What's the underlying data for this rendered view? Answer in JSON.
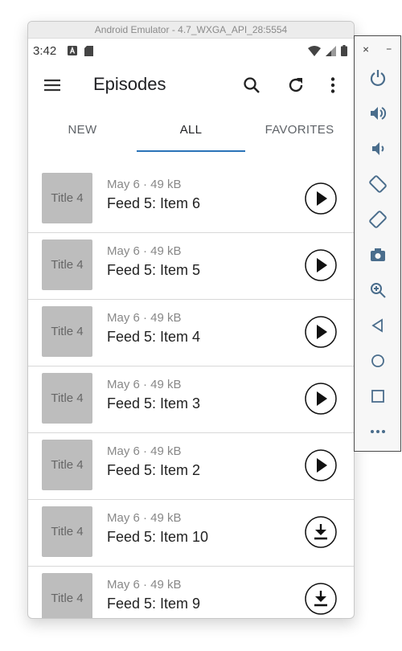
{
  "emulator": {
    "window_title": "Android Emulator - 4.7_WXGA_API_28:5554",
    "panel": {
      "close": "×",
      "minimize": "−",
      "tools": [
        "power-icon",
        "volume-up-icon",
        "volume-down-icon",
        "rotate-left-icon",
        "rotate-right-icon",
        "camera-icon",
        "zoom-icon",
        "back-icon",
        "home-icon",
        "overview-icon",
        "more-icon"
      ]
    }
  },
  "status_bar": {
    "time": "3:42"
  },
  "app_bar": {
    "title": "Episodes"
  },
  "tabs": [
    {
      "label": "NEW"
    },
    {
      "label": "ALL"
    },
    {
      "label": "FAVORITES"
    }
  ],
  "episodes": [
    {
      "thumb": "Title 4",
      "meta": "May 6 · 49 kB",
      "title": "Feed 5: Item 6",
      "action": "play"
    },
    {
      "thumb": "Title 4",
      "meta": "May 6 · 49 kB",
      "title": "Feed 5: Item 5",
      "action": "play"
    },
    {
      "thumb": "Title 4",
      "meta": "May 6 · 49 kB",
      "title": "Feed 5: Item 4",
      "action": "play"
    },
    {
      "thumb": "Title 4",
      "meta": "May 6 · 49 kB",
      "title": "Feed 5: Item 3",
      "action": "play"
    },
    {
      "thumb": "Title 4",
      "meta": "May 6 · 49 kB",
      "title": "Feed 5: Item 2",
      "action": "play"
    },
    {
      "thumb": "Title 4",
      "meta": "May 6 · 49 kB",
      "title": "Feed 5: Item 10",
      "action": "download"
    },
    {
      "thumb": "Title 4",
      "meta": "May 6 · 49 kB",
      "title": "Feed 5: Item 9",
      "action": "download"
    }
  ]
}
